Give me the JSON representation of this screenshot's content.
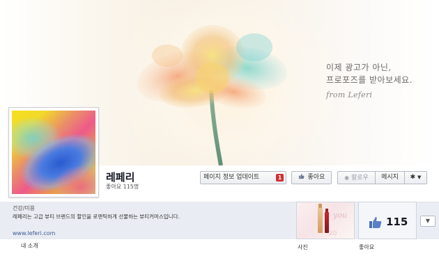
{
  "cover": {
    "line1": "이제 광고가 아닌,",
    "line2": "프로포즈를 받아보세요.",
    "signature": "from Leferi"
  },
  "page": {
    "name": "레페리",
    "likes_text": "좋아요 115명"
  },
  "actions": {
    "update_label": "페이지 정보 업데이트",
    "update_badge": "1",
    "like_label": "좋아요",
    "follow_label": "팔로우",
    "message_label": "메시지",
    "gear_icon": "gear-icon",
    "thumb_icon": "thumbs-up-icon",
    "rss_icon": "rss-icon"
  },
  "about": {
    "category": "건강/미용",
    "description": "레페리는 고급 뷰티 브랜드의 할인을 로맨틱하게 선물하는 뷰티커머스입니다.",
    "url": "www.leferi.com",
    "section_label": "내 소개"
  },
  "apps": {
    "photo_label": "사진",
    "photo_overlay_num": "20",
    "likes_label": "좋아요",
    "likes_count": "115"
  },
  "colors": {
    "badge": "#d32f2f",
    "link": "#3b5998",
    "strip": "#eaedf3"
  }
}
